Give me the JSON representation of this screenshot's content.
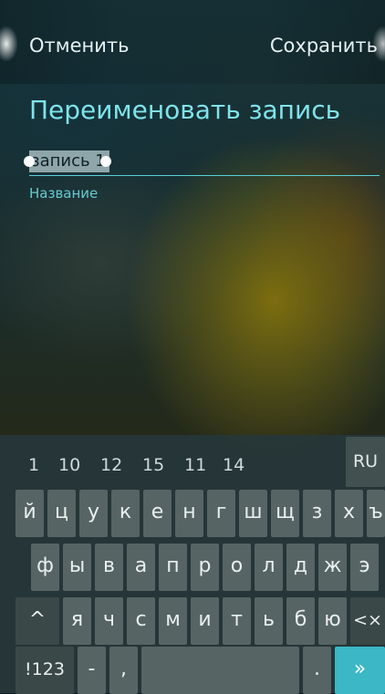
{
  "header": {
    "cancel_label": "Отменить",
    "save_label": "Сохранить"
  },
  "dialog": {
    "title": "Переименовать запись",
    "field_value": "запись 1",
    "field_label": "Название"
  },
  "keyboard": {
    "suggestions": [
      "1",
      "10",
      "12",
      "15",
      "11",
      "14"
    ],
    "language": "RU",
    "row1": [
      "й",
      "ц",
      "у",
      "к",
      "е",
      "н",
      "г",
      "ш",
      "щ",
      "з",
      "х",
      "ъ"
    ],
    "row2": [
      "ф",
      "ы",
      "в",
      "а",
      "п",
      "р",
      "о",
      "л",
      "д",
      "ж",
      "э"
    ],
    "row3": [
      "я",
      "ч",
      "с",
      "м",
      "и",
      "т",
      "ь",
      "б",
      "ю"
    ],
    "shift_symbol": "^",
    "backspace_symbol": "<×",
    "symbols_label": "!123",
    "dash": "-",
    "comma": ",",
    "period": ".",
    "enter_symbol": "»"
  },
  "colors": {
    "accent": "#3bb7c5",
    "title": "#7fe3ea"
  }
}
